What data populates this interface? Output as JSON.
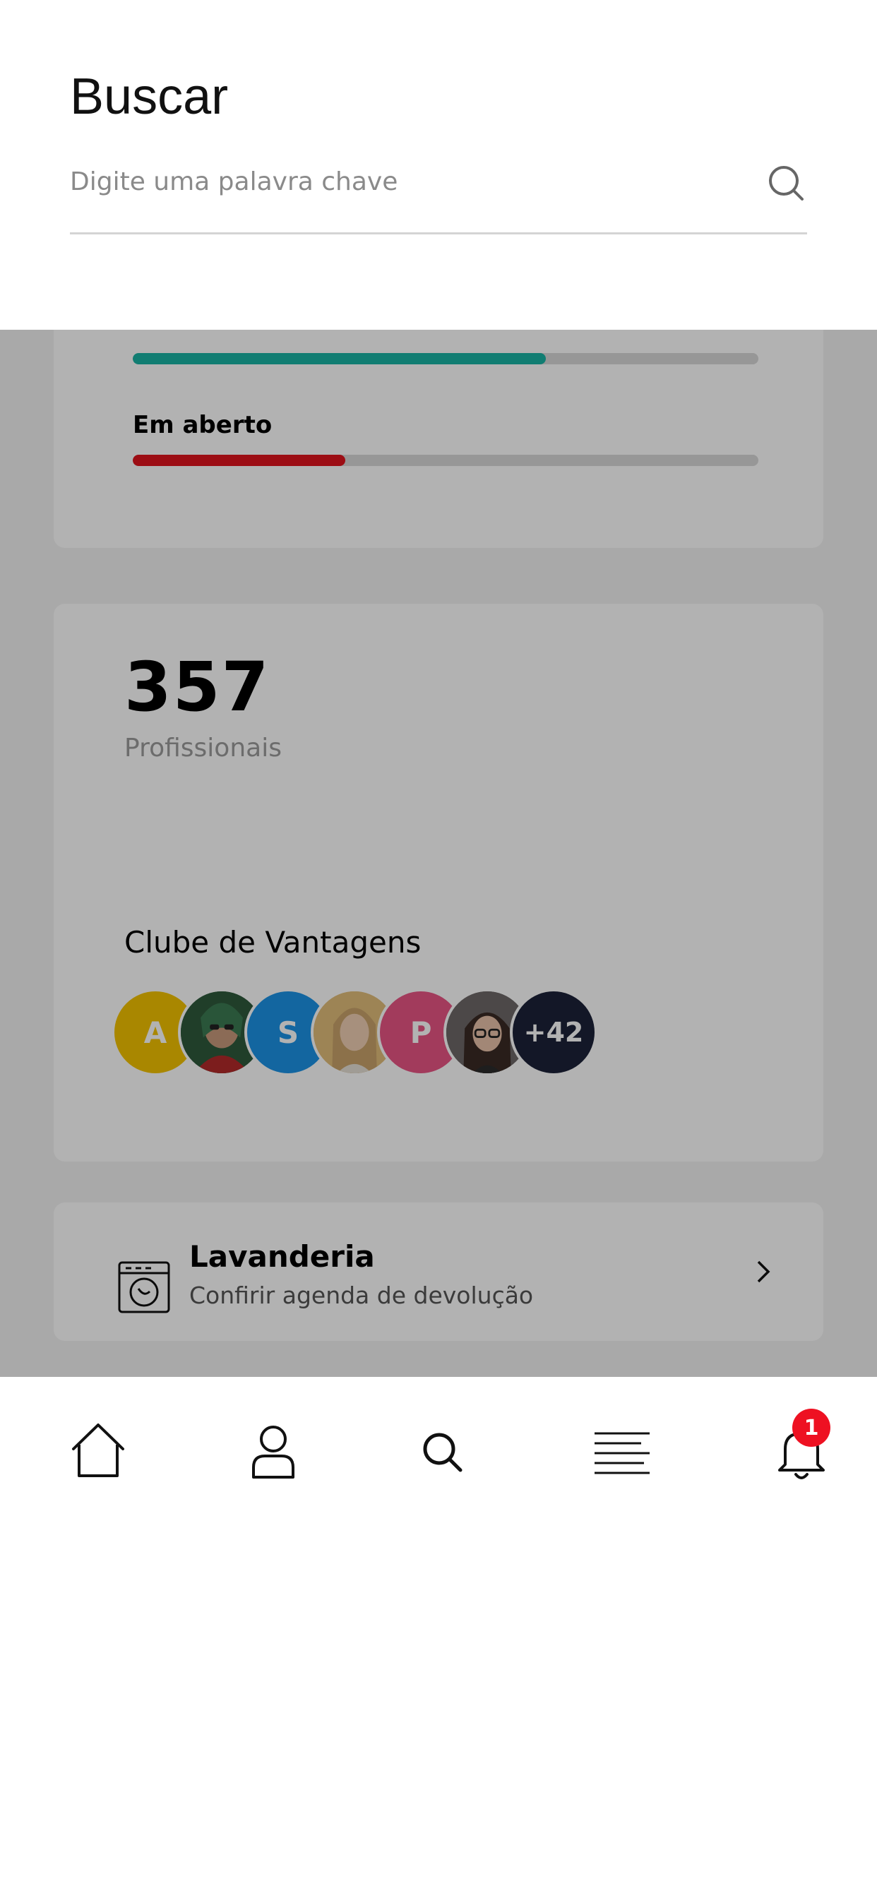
{
  "search": {
    "title": "Buscar",
    "placeholder": "Digite uma palavra chave",
    "value": ""
  },
  "progress": {
    "items": [
      {
        "label": "",
        "fraction": 0.66,
        "color": "#19b4a4"
      },
      {
        "label": "Em aberto",
        "fraction": 0.34,
        "color": "#e0141e"
      }
    ]
  },
  "stats": {
    "number": "357",
    "number_label": "Profissionais"
  },
  "club": {
    "title": "Clube de Vantagens",
    "avatars": [
      {
        "initial": "A",
        "color": "#f2c200",
        "icon": ""
      },
      {
        "initial": "",
        "color": "#2e5a3c",
        "icon": "person-photo-hoodie"
      },
      {
        "initial": "S",
        "color": "#1c93e6",
        "icon": ""
      },
      {
        "initial": "",
        "color": "#d9b26a",
        "icon": "person-photo-blonde"
      },
      {
        "initial": "P",
        "color": "#e85584",
        "icon": ""
      },
      {
        "initial": "",
        "color": "#5a5656",
        "icon": "person-photo-glasses"
      },
      {
        "initial": "+42",
        "color": "#1c2238",
        "icon": ""
      }
    ]
  },
  "laundry": {
    "title": "Lavanderia",
    "subtitle": "Confirir agenda de devolução",
    "icon": "washing-machine-icon"
  },
  "nav": {
    "items": [
      "home-icon",
      "user-icon",
      "search-icon",
      "menu-icon",
      "bell-icon"
    ],
    "notification_count": "1"
  }
}
